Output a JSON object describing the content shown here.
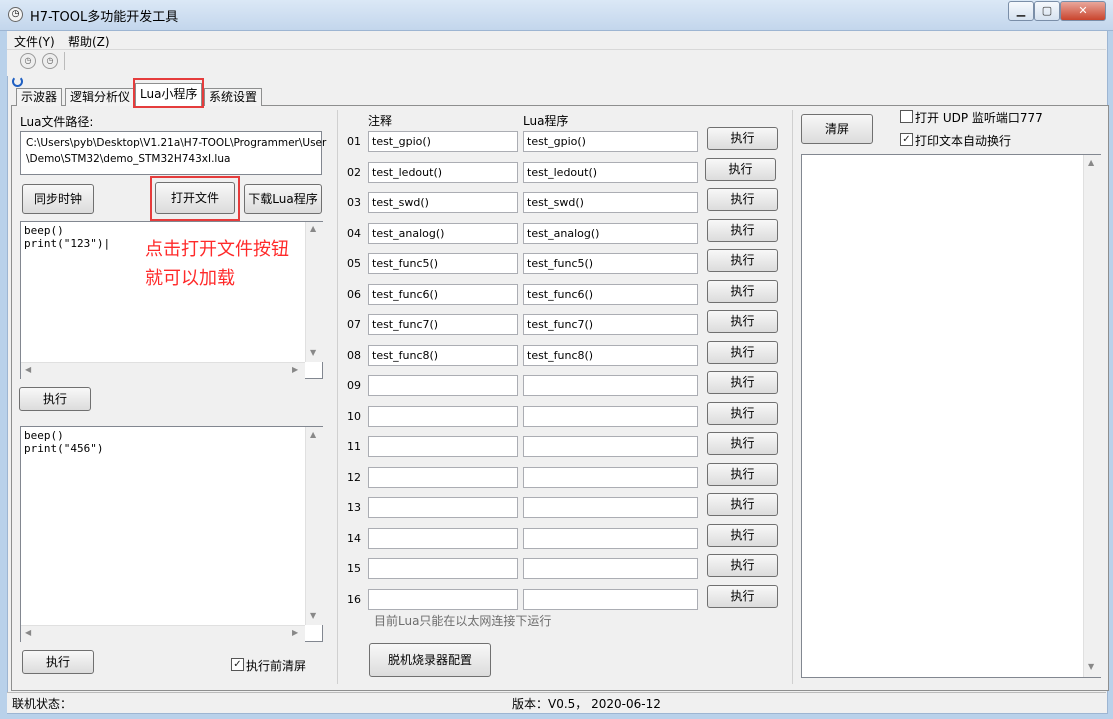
{
  "window": {
    "title": "H7-TOOL多功能开发工具",
    "app_icon": "clock-icon",
    "buttons": {
      "minimize": "▁",
      "maximize": "▢",
      "close": "✕"
    }
  },
  "menu": [
    "文件(Y)",
    "帮助(Z)"
  ],
  "toolbar": {
    "icons": [
      "clock-icon",
      "clock-icon"
    ]
  },
  "tabs": [
    "示波器",
    "逻辑分析仪",
    "Lua小程序",
    "系统设置"
  ],
  "left_panel": {
    "path_label": "Lua文件路径:",
    "path_line1": "C:\\Users\\pyb\\Desktop\\V1.21a\\H7-TOOL\\Programmer\\User",
    "path_line2": "\\Demo\\STM32\\demo_STM32H743xI.lua",
    "sync_clock": "同步时钟",
    "open_file": "打开文件",
    "download_lua": "下载Lua程序",
    "editor1": "beep()\nprint(\"123\")|",
    "annotation_line1": "点击打开文件按钮",
    "annotation_line2": "就可以加载",
    "exec1": "执行",
    "editor2": "beep()\nprint(\"456\")",
    "exec2": "执行",
    "clear_before_label": "执行前清屏",
    "clear_before_checked": "✓"
  },
  "mid_panel": {
    "col_comment": "注释",
    "col_program": "Lua程序",
    "rows": [
      {
        "no": "01",
        "comment": "test_gpio()",
        "program": "test_gpio()",
        "btn": "执行"
      },
      {
        "no": "02",
        "comment": "test_ledout()",
        "program": "test_ledout()",
        "btn": "执行"
      },
      {
        "no": "03",
        "comment": "test_swd()",
        "program": "test_swd()",
        "btn": "执行"
      },
      {
        "no": "04",
        "comment": "test_analog()",
        "program": "test_analog()",
        "btn": "执行"
      },
      {
        "no": "05",
        "comment": "test_func5()",
        "program": "test_func5()",
        "btn": "执行"
      },
      {
        "no": "06",
        "comment": "test_func6()",
        "program": "test_func6()",
        "btn": "执行"
      },
      {
        "no": "07",
        "comment": "test_func7()",
        "program": "test_func7()",
        "btn": "执行"
      },
      {
        "no": "08",
        "comment": "test_func8()",
        "program": "test_func8()",
        "btn": "执行"
      },
      {
        "no": "09",
        "comment": "",
        "program": "",
        "btn": "执行"
      },
      {
        "no": "10",
        "comment": "",
        "program": "",
        "btn": "执行"
      },
      {
        "no": "11",
        "comment": "",
        "program": "",
        "btn": "执行"
      },
      {
        "no": "12",
        "comment": "",
        "program": "",
        "btn": "执行"
      },
      {
        "no": "13",
        "comment": "",
        "program": "",
        "btn": "执行"
      },
      {
        "no": "14",
        "comment": "",
        "program": "",
        "btn": "执行"
      },
      {
        "no": "15",
        "comment": "",
        "program": "",
        "btn": "执行"
      },
      {
        "no": "16",
        "comment": "",
        "program": "",
        "btn": "执行"
      }
    ],
    "note": "目前Lua只能在以太网连接下运行",
    "offline_config": "脱机烧录器配置"
  },
  "right_panel": {
    "clear_screen": "清屏",
    "udp_label": "打开 UDP 监听端口777",
    "udp_checked": "",
    "autowrap_label": "打印文本自动换行",
    "autowrap_checked": "✓"
  },
  "status": {
    "conn_label": "联机状态：",
    "version": "版本：V0.5， 2020-06-12"
  }
}
